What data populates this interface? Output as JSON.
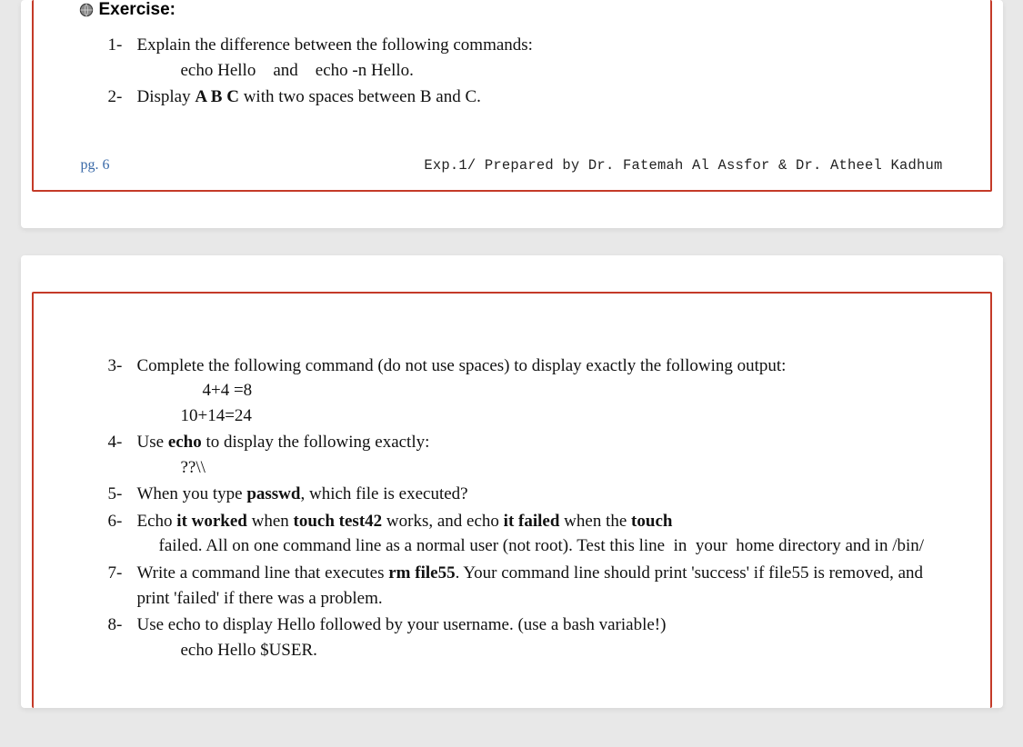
{
  "exercise": {
    "title": "Exercise:",
    "q1": {
      "num": "1-",
      "text": "Explain the difference between the following commands:",
      "sub": "echo Hello    and    echo -n Hello."
    },
    "q2": {
      "num": "2-",
      "pre": "Display ",
      "bold": "A B C",
      "post": " with two spaces between B and C."
    },
    "q3": {
      "num": "3-",
      "text": "Complete the following command (do not use spaces) to display exactly the following output:",
      "line_a": "4+4 =8",
      "line_b": "10+14=24"
    },
    "q4": {
      "num": "4-",
      "pre": "Use ",
      "bold": "echo",
      "post": " to display the following exactly:",
      "line": "??\\\\"
    },
    "q5": {
      "num": "5-",
      "pre": "When you type ",
      "bold": "passwd",
      "post": ", which file is executed?"
    },
    "q6": {
      "num": "6-",
      "a": "Echo ",
      "b": "it worked",
      "c": " when ",
      "d": "touch test42",
      "e": " works, and echo ",
      "f": "it failed",
      "g": " when the ",
      "h": "touch",
      "line2": "failed. All on one command line as a normal user (not root). Test this line  in  your  home directory and in /bin/"
    },
    "q7": {
      "num": "7-",
      "a": "Write a command line that executes ",
      "b": "rm file55",
      "c": ". Your command line should print 'success' if file55 is removed, and print 'failed' if there was a problem."
    },
    "q8": {
      "num": "8-",
      "text": "Use echo to display Hello followed by your username. (use a bash variable!)",
      "line": "echo Hello $USER."
    }
  },
  "footer": {
    "pg": "pg. 6",
    "prep": "Exp.1/ Prepared by Dr. Fatemah Al Assfor & Dr. Atheel Kadhum"
  }
}
